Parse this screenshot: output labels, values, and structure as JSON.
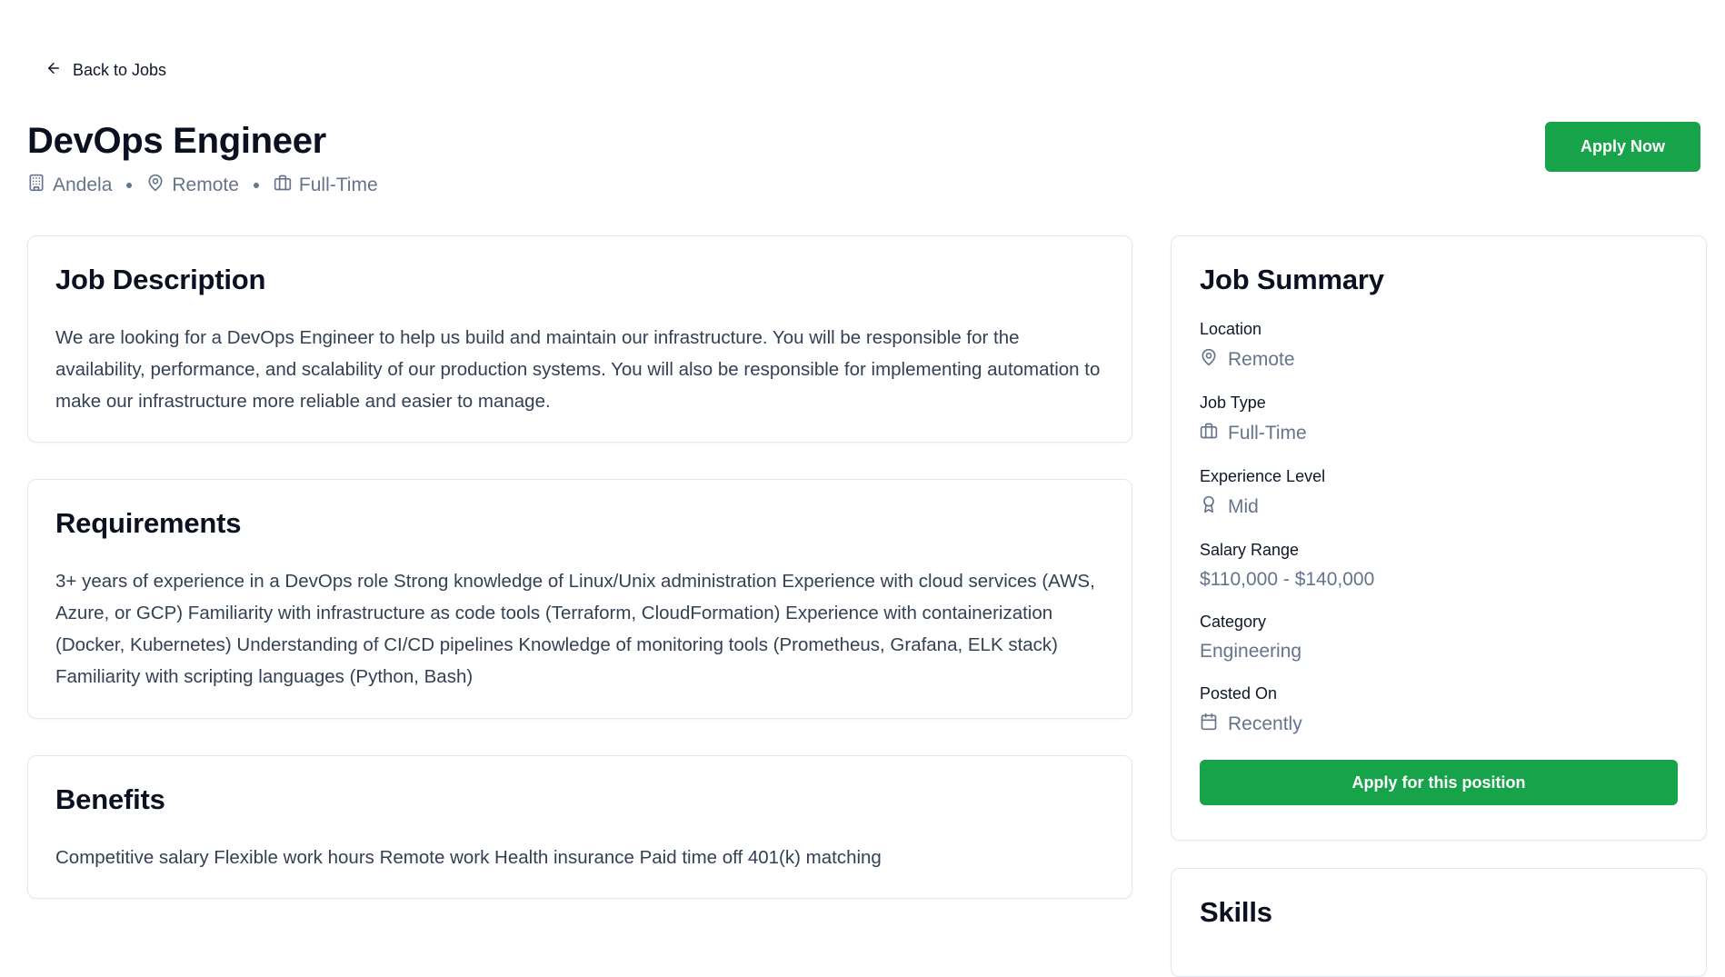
{
  "nav": {
    "back_label": "Back to Jobs"
  },
  "job": {
    "title": "DevOps Engineer",
    "company": "Andela",
    "location": "Remote",
    "type": "Full-Time",
    "apply_label": "Apply Now"
  },
  "description": {
    "heading": "Job Description",
    "text": "We are looking for a DevOps Engineer to help us build and maintain our infrastructure. You will be responsible for the availability, performance, and scalability of our production systems. You will also be responsible for implementing automation to make our infrastructure more reliable and easier to manage."
  },
  "requirements": {
    "heading": "Requirements",
    "text": "3+ years of experience in a DevOps role Strong knowledge of Linux/Unix administration Experience with cloud services (AWS, Azure, or GCP) Familiarity with infrastructure as code tools (Terraform, CloudFormation) Experience with containerization (Docker, Kubernetes) Understanding of CI/CD pipelines Knowledge of monitoring tools (Prometheus, Grafana, ELK stack) Familiarity with scripting languages (Python, Bash)"
  },
  "benefits": {
    "heading": "Benefits",
    "text": "Competitive salary Flexible work hours Remote work Health insurance Paid time off 401(k) matching"
  },
  "summary": {
    "heading": "Job Summary",
    "location_label": "Location",
    "location_value": "Remote",
    "type_label": "Job Type",
    "type_value": "Full-Time",
    "experience_label": "Experience Level",
    "experience_value": "Mid",
    "salary_label": "Salary Range",
    "salary_value": "$110,000 - $140,000",
    "category_label": "Category",
    "category_value": "Engineering",
    "posted_label": "Posted On",
    "posted_value": "Recently",
    "apply_label": "Apply for this position"
  },
  "skills": {
    "heading": "Skills"
  },
  "colors": {
    "accent": "#16a34a",
    "muted": "#64748b",
    "border": "#e2e8f0"
  },
  "icons": [
    "arrow-left-icon",
    "building-icon",
    "map-pin-icon",
    "briefcase-icon",
    "award-icon",
    "calendar-icon"
  ]
}
